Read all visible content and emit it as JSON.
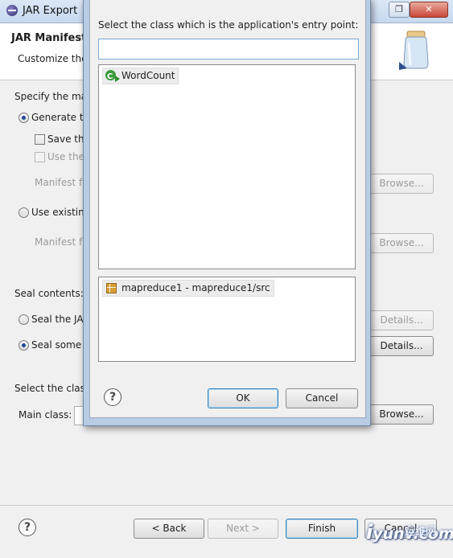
{
  "outer": {
    "title": "JAR Export",
    "header_title": "JAR Manifest S",
    "header_desc": "Customize the",
    "specify_label": "Specify the ma",
    "generate_label": "Generate th",
    "save_label": "Save th",
    "use_the_label": "Use the",
    "manifest_file_label_1": "Manifest f",
    "use_existing_label": "Use existin",
    "manifest_file_label_2": "Manifest f",
    "browse_label": "Browse...",
    "seal_contents_label": "Seal contents:",
    "seal_jar_label": "Seal the JA",
    "seal_some_label": "Seal some",
    "details_label": "Details...",
    "select_class_label": "Select the class",
    "main_class_label": "Main class:",
    "back_label": "< Back",
    "next_label": "Next >",
    "finish_label": "Finish",
    "cancel_label": "Cancel",
    "help_glyph": "?"
  },
  "dialog": {
    "prompt": "Select the class which is the application's entry point:",
    "filter_value": "",
    "classes": [
      {
        "name": "WordCount",
        "icon": "class-runnable-icon"
      }
    ],
    "packages": [
      {
        "name": "mapreduce1 - mapreduce1/src",
        "icon": "package-icon"
      }
    ],
    "ok_label": "OK",
    "cancel_label": "Cancel",
    "help_glyph": "?"
  },
  "watermark": {
    "text_big": "i",
    "text": "yunv.com",
    "text_cn": "运维网"
  }
}
